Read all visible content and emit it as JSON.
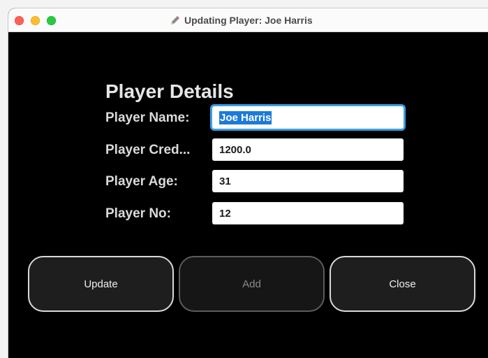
{
  "window": {
    "title": "Updating Player: Joe Harris",
    "title_icon": "pencil-icon"
  },
  "form": {
    "heading": "Player Details",
    "fields": [
      {
        "label": "Player Name:",
        "value": "Joe Harris",
        "selected": true
      },
      {
        "label": "Player Cred...",
        "value": "1200.0"
      },
      {
        "label": "Player Age:",
        "value": "31"
      },
      {
        "label": "Player No:",
        "value": "12"
      }
    ]
  },
  "buttons": {
    "update": "Update",
    "add": "Add",
    "close": "Close"
  },
  "colors": {
    "background": "#000000",
    "focus_ring": "#3aa0e6",
    "selection": "#1d7ad8"
  }
}
